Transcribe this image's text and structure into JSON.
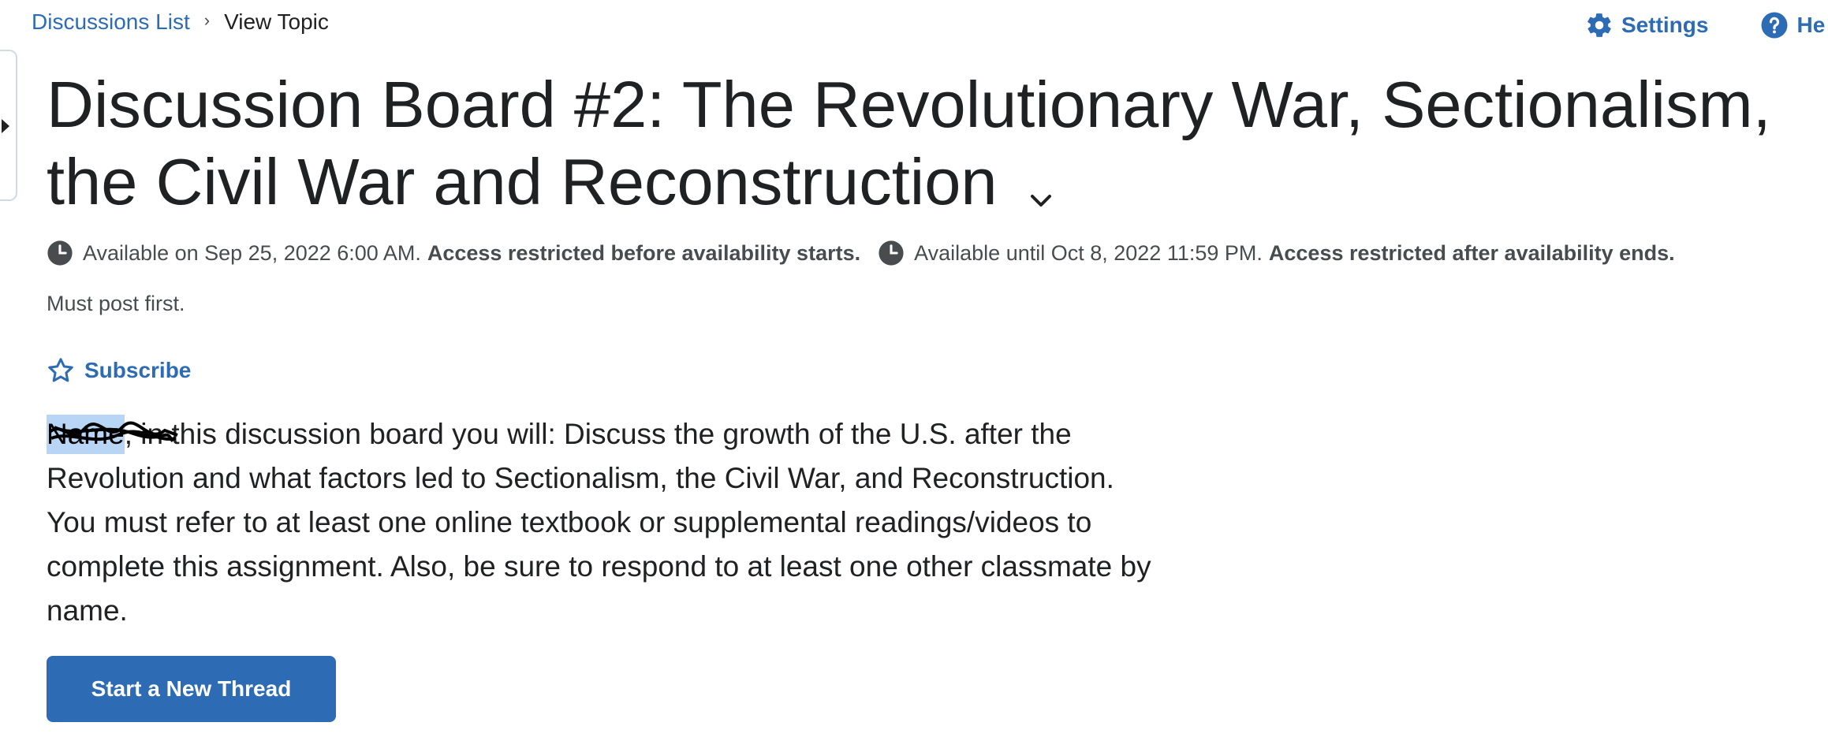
{
  "breadcrumb": {
    "parent": "Discussions List",
    "separator": "›",
    "current": "View Topic"
  },
  "toolbar": {
    "settings_label": "Settings",
    "help_label": "He"
  },
  "topic": {
    "title": "Discussion Board #2: The Revolutionary War, Sectionalism, the Civil War and Reconstruction",
    "availability_start": "Available on Sep 25, 2022 6:00 AM.",
    "availability_start_note": "Access restricted before availability starts.",
    "availability_end": "Available until Oct 8, 2022 11:59 PM.",
    "availability_end_note": "Access restricted after availability ends.",
    "must_post": "Must post first.",
    "subscribe_label": "Subscribe",
    "description_name": "Name",
    "description_body": ", in this discussion board you will: Discuss the growth of the U.S. after the Revolution and what factors led to Sectionalism, the Civil War, and Reconstruction. You must refer to at least one online textbook or supplemental readings/videos to complete this assignment.  Also, be sure to respond to at least one other classmate by name.",
    "new_thread_label": "Start a New Thread"
  },
  "colors": {
    "link": "#2d6cb5",
    "text": "#202122",
    "muted": "#494c4e",
    "highlight": "#b9d5f5"
  }
}
